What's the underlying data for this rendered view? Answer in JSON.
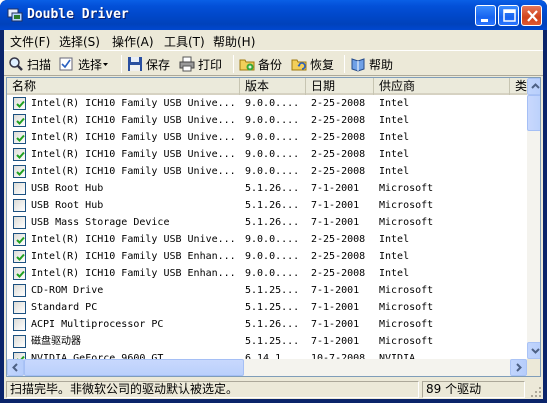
{
  "window": {
    "title": "Double Driver"
  },
  "menu": [
    "文件(F)",
    "选择(S)",
    "操作(A)",
    "工具(T)",
    "帮助(H)"
  ],
  "toolbar": {
    "scan": "扫描",
    "select": "选择",
    "save": "保存",
    "print": "打印",
    "backup": "备份",
    "restore": "恢复",
    "help": "帮助"
  },
  "columns": [
    "名称",
    "版本",
    "日期",
    "供应商",
    "类"
  ],
  "rows": [
    {
      "checked": true,
      "name": "Intel(R) ICH10 Family USB Unive...",
      "version": "9.0.0....",
      "date": "2-25-2008",
      "vendor": "Intel"
    },
    {
      "checked": true,
      "name": "Intel(R) ICH10 Family USB Unive...",
      "version": "9.0.0....",
      "date": "2-25-2008",
      "vendor": "Intel"
    },
    {
      "checked": true,
      "name": "Intel(R) ICH10 Family USB Unive...",
      "version": "9.0.0....",
      "date": "2-25-2008",
      "vendor": "Intel"
    },
    {
      "checked": true,
      "name": "Intel(R) ICH10 Family USB Unive...",
      "version": "9.0.0....",
      "date": "2-25-2008",
      "vendor": "Intel"
    },
    {
      "checked": true,
      "name": "Intel(R) ICH10 Family USB Unive...",
      "version": "9.0.0....",
      "date": "2-25-2008",
      "vendor": "Intel"
    },
    {
      "checked": false,
      "name": "USB Root Hub",
      "version": "5.1.26...",
      "date": "7-1-2001",
      "vendor": "Microsoft"
    },
    {
      "checked": false,
      "name": "USB Root Hub",
      "version": "5.1.26...",
      "date": "7-1-2001",
      "vendor": "Microsoft"
    },
    {
      "checked": false,
      "name": "USB Mass Storage Device",
      "version": "5.1.26...",
      "date": "7-1-2001",
      "vendor": "Microsoft"
    },
    {
      "checked": true,
      "name": "Intel(R) ICH10 Family USB Unive...",
      "version": "9.0.0....",
      "date": "2-25-2008",
      "vendor": "Intel"
    },
    {
      "checked": true,
      "name": "Intel(R) ICH10 Family USB Enhan...",
      "version": "9.0.0....",
      "date": "2-25-2008",
      "vendor": "Intel"
    },
    {
      "checked": true,
      "name": "Intel(R) ICH10 Family USB Enhan...",
      "version": "9.0.0....",
      "date": "2-25-2008",
      "vendor": "Intel"
    },
    {
      "checked": false,
      "name": "CD-ROM Drive",
      "version": "5.1.25...",
      "date": "7-1-2001",
      "vendor": "Microsoft"
    },
    {
      "checked": false,
      "name": "Standard PC",
      "version": "5.1.25...",
      "date": "7-1-2001",
      "vendor": "Microsoft"
    },
    {
      "checked": false,
      "name": "ACPI Multiprocessor PC",
      "version": "5.1.26...",
      "date": "7-1-2001",
      "vendor": "Microsoft"
    },
    {
      "checked": false,
      "name": "磁盘驱动器",
      "version": "5.1.25...",
      "date": "7-1-2001",
      "vendor": "Microsoft"
    },
    {
      "checked": true,
      "name": "NVIDIA GeForce 9600 GT",
      "version": "6.14.1...",
      "date": "10-7-2008",
      "vendor": "NVIDIA"
    }
  ],
  "status": {
    "message": "扫描完毕。非微软公司的驱动默认被选定。",
    "count": "89 个驱动"
  }
}
